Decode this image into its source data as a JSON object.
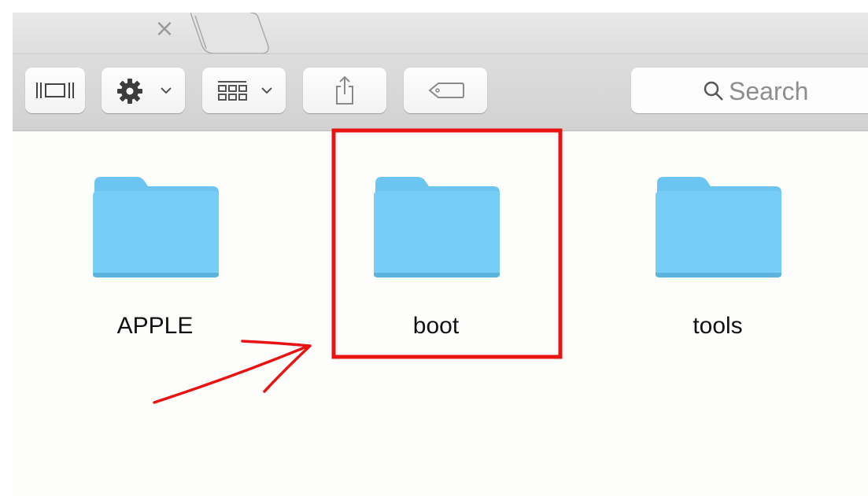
{
  "tabbar": {
    "close_glyph": "×"
  },
  "toolbar": {
    "buttons": [
      {
        "icon": "cover-flow-icon"
      },
      {
        "icon": "gear-icon",
        "has_menu": true
      },
      {
        "icon": "arrange-grid-icon",
        "has_menu": true
      },
      {
        "icon": "share-icon"
      },
      {
        "icon": "tag-icon"
      }
    ],
    "search": {
      "placeholder": "Search",
      "icon": "search-icon"
    }
  },
  "files": [
    {
      "name": "APPLE",
      "type": "folder",
      "highlighted": false
    },
    {
      "name": "boot",
      "type": "folder",
      "highlighted": true
    },
    {
      "name": "tools",
      "type": "folder",
      "highlighted": false
    }
  ],
  "colors": {
    "folder_top": "#6cc4f1",
    "folder_body": "#76cdf6",
    "annotation": "#e81414"
  }
}
